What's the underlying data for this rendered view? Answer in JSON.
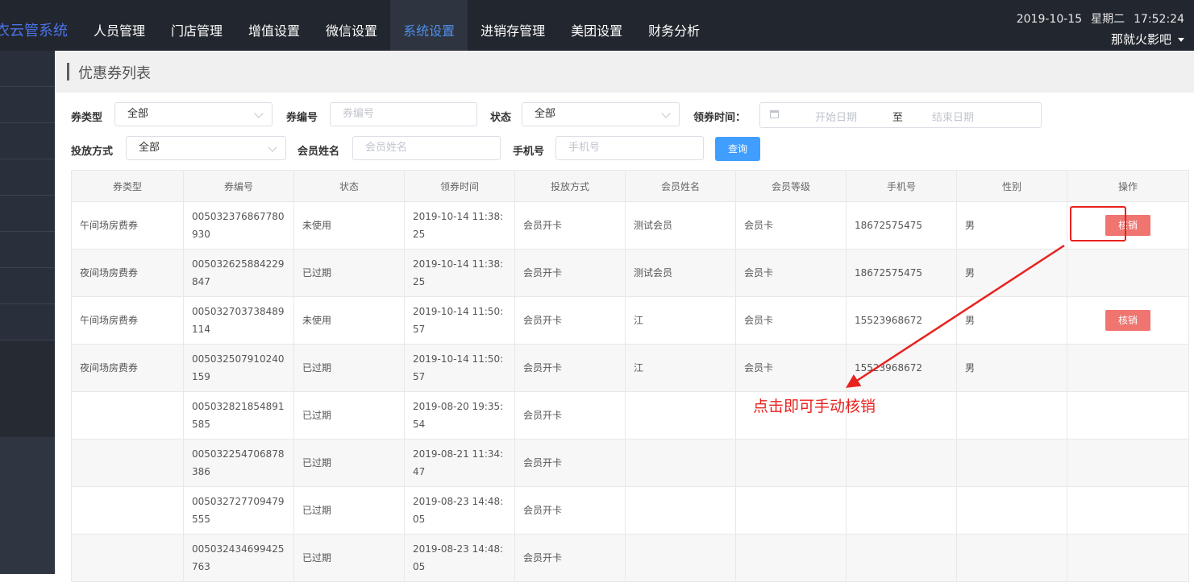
{
  "topbar": {
    "brand": "衣云管系统",
    "nav": [
      "人员管理",
      "门店管理",
      "增值设置",
      "微信设置",
      "系统设置",
      "进销存管理",
      "美团设置",
      "财务分析"
    ],
    "active_nav": "系统设置",
    "date": "2019-10-15",
    "weekday": "星期二",
    "time": "17:52:24",
    "user": "那就火影吧"
  },
  "page": {
    "title": "优惠券列表"
  },
  "filters": {
    "coupon_type_label": "券类型",
    "coupon_type_value": "全部",
    "coupon_no_label": "券编号",
    "coupon_no_placeholder": "券编号",
    "status_label": "状态",
    "status_value": "全部",
    "receive_time_label": "领券时间：",
    "start_placeholder": "开始日期",
    "range_sep": "至",
    "end_placeholder": "结束日期",
    "delivery_label": "投放方式",
    "delivery_value": "全部",
    "member_name_label": "会员姓名",
    "member_name_placeholder": "会员姓名",
    "phone_label": "手机号",
    "phone_placeholder": "手机号",
    "query_button": "查询"
  },
  "table": {
    "headers": [
      "券类型",
      "券编号",
      "状态",
      "领券时间",
      "投放方式",
      "会员姓名",
      "会员等级",
      "手机号",
      "性别",
      "操作"
    ],
    "rows": [
      {
        "type": "午间场房费券",
        "no": "005032376867780930",
        "status": "未使用",
        "time": "2019-10-14 11:38:25",
        "delivery": "会员开卡",
        "name": "测试会员",
        "level": "会员卡",
        "phone": "18672575475",
        "gender": "男",
        "action": "核销"
      },
      {
        "type": "夜间场房费券",
        "no": "005032625884229847",
        "status": "已过期",
        "time": "2019-10-14 11:38:25",
        "delivery": "会员开卡",
        "name": "测试会员",
        "level": "会员卡",
        "phone": "18672575475",
        "gender": "男",
        "action": ""
      },
      {
        "type": "午间场房费券",
        "no": "005032703738489114",
        "status": "未使用",
        "time": "2019-10-14 11:50:57",
        "delivery": "会员开卡",
        "name": "江",
        "level": "会员卡",
        "phone": "15523968672",
        "gender": "男",
        "action": "核销"
      },
      {
        "type": "夜间场房费券",
        "no": "005032507910240159",
        "status": "已过期",
        "time": "2019-10-14 11:50:57",
        "delivery": "会员开卡",
        "name": "江",
        "level": "会员卡",
        "phone": "15523968672",
        "gender": "男",
        "action": ""
      },
      {
        "type": "",
        "no": "005032821854891585",
        "status": "已过期",
        "time": "2019-08-20 19:35:54",
        "delivery": "会员开卡",
        "name": "",
        "level": "",
        "phone": "",
        "gender": "",
        "action": ""
      },
      {
        "type": "",
        "no": "005032254706878386",
        "status": "已过期",
        "time": "2019-08-21 11:34:47",
        "delivery": "会员开卡",
        "name": "",
        "level": "",
        "phone": "",
        "gender": "",
        "action": ""
      },
      {
        "type": "",
        "no": "005032727709479555",
        "status": "已过期",
        "time": "2019-08-23 14:48:05",
        "delivery": "会员开卡",
        "name": "",
        "level": "",
        "phone": "",
        "gender": "",
        "action": ""
      },
      {
        "type": "",
        "no": "005032434699425763",
        "status": "已过期",
        "time": "2019-08-23 14:48:05",
        "delivery": "会员开卡",
        "name": "",
        "level": "",
        "phone": "",
        "gender": "",
        "action": ""
      }
    ]
  },
  "annotation": {
    "text": "点击即可手动核销",
    "color": "#e8221e"
  }
}
